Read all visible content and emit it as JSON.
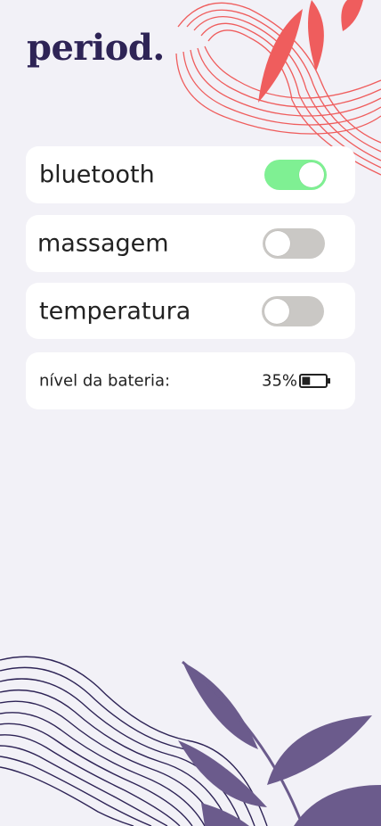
{
  "app": {
    "logo": "period."
  },
  "settings": [
    {
      "label": "bluetooth",
      "on": true
    },
    {
      "label": "massagem",
      "on": false
    },
    {
      "label": "temperatura",
      "on": false
    }
  ],
  "battery": {
    "label": "nível da bateria:",
    "value": "35%",
    "level": 0.35
  },
  "colors": {
    "brand": "#2e2456",
    "toggle_on": "#7ff093",
    "toggle_off": "#cac8c5",
    "accent_top": "#ef5d5d",
    "accent_bottom": "#6b5b8c"
  }
}
